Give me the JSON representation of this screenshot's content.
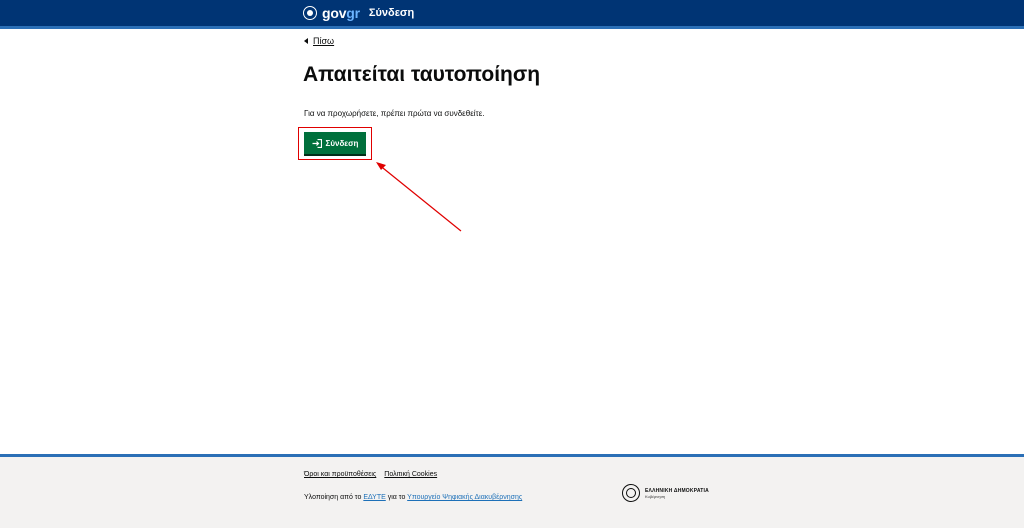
{
  "header": {
    "brand_gov": "gov",
    "brand_gr": "gr",
    "title": "Σύνδεση"
  },
  "back_link": {
    "label": "Πίσω"
  },
  "main": {
    "heading": "Απαιτείται ταυτοποίηση",
    "paragraph": "Για να προχωρήσετε, πρέπει πρώτα να συνδεθείτε.",
    "login_button": "Σύνδεση"
  },
  "footer": {
    "links": [
      "Όροι και προϋποθέσεις",
      "Πολιτική Cookies"
    ],
    "credit_prefix": "Υλοποίηση από το",
    "credit_org": "ΕΔΥΤΕ",
    "credit_middle": "για το",
    "credit_ministry": "Υπουργείο Ψηφιακής Διακυβέρνησης",
    "logo_line1": "ΕΛΛΗΝΙΚΗ ΔΗΜΟΚΡΑΤΙΑ",
    "logo_line2": "Κυβέρνηση"
  },
  "colors": {
    "header_bg": "#003474",
    "button_bg": "#00703c",
    "annotation": "#e00000"
  },
  "icons": {
    "brand": "greek-emblem-icon",
    "back": "caret-left-icon",
    "login": "sign-in-icon",
    "seal": "hellenic-republic-seal-icon"
  }
}
